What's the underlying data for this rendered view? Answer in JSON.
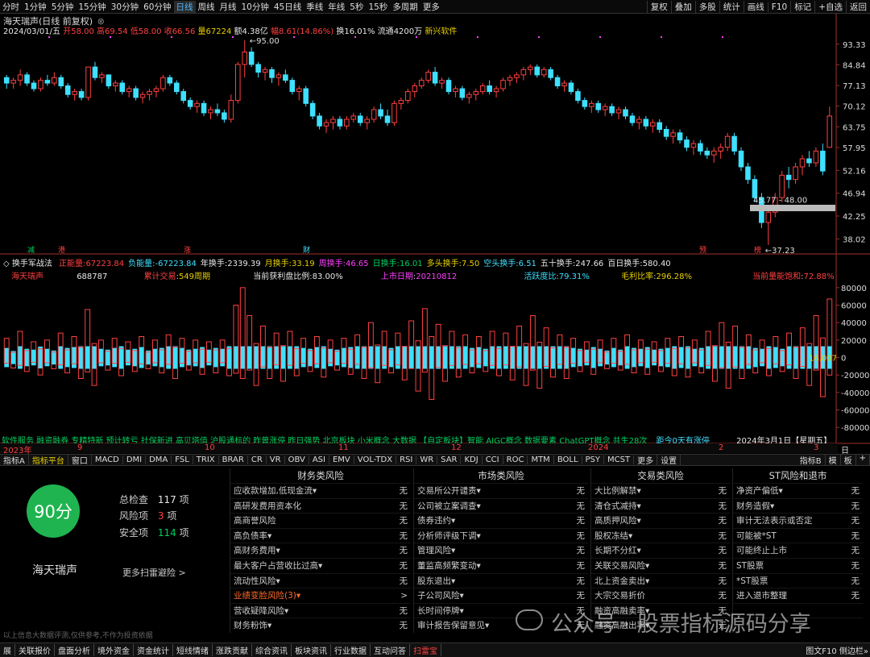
{
  "period_tabs": [
    "分时",
    "1分钟",
    "5分钟",
    "15分钟",
    "30分钟",
    "60分钟",
    "日线",
    "周线",
    "月线",
    "10分钟",
    "45日线",
    "季线",
    "年线",
    "5秒",
    "15秒",
    "多周期",
    "更多"
  ],
  "active_period": "日线",
  "right_tools": [
    "复权",
    "叠加",
    "多股",
    "统计",
    "画线",
    "F10",
    "标记",
    "+自选",
    "返回"
  ],
  "stock": {
    "title": "海天瑞声(日线 前复权)",
    "date": "2024/03/01/五"
  },
  "ohlc": {
    "open_label": "开",
    "open": "58.00",
    "high_label": "高",
    "high": "69.54",
    "low_label": "低",
    "low": "58.00",
    "close_label": "收",
    "close": "66.56",
    "vol_label": "量",
    "vol": "67224",
    "amt_label": "额",
    "amt": "4.38亿",
    "chg_label": "幅",
    "chg": "8.61(14.86%)",
    "turn_label": "换",
    "turn": "16.01%",
    "float_label": "流通",
    "float": "4200万",
    "concept": "新兴软件"
  },
  "price_axis": [
    "93.33",
    "84.84",
    "77.13",
    "70.12",
    "63.75",
    "57.95",
    "52.16",
    "46.94",
    "42.25",
    "38.02"
  ],
  "annotations": {
    "high": "95.00",
    "range": "45.77 - 48.00",
    "low": "37.23"
  },
  "markers": [
    "减",
    "港",
    "涨",
    "财",
    "预",
    "榜"
  ],
  "sub": {
    "name": "换手军战法",
    "items": [
      {
        "label": "正能量",
        "value": "67223.84",
        "color": "red"
      },
      {
        "label": "负能量",
        "value": "-67223.84",
        "color": "cyn"
      },
      {
        "label": "年换手",
        "value": "2339.39",
        "color": "wht"
      },
      {
        "label": "月换手",
        "value": "33.19",
        "color": "yel"
      },
      {
        "label": "周换手",
        "value": "46.65",
        "color": "mag"
      },
      {
        "label": "日换手",
        "value": "16.01",
        "color": "grn"
      },
      {
        "label": "多头换手",
        "value": "7.50",
        "color": "yel"
      },
      {
        "label": "空头换手",
        "value": "6.51",
        "color": "cyn"
      },
      {
        "label": "五十换手",
        "value": "247.66",
        "color": "wht"
      },
      {
        "label": "百日换手",
        "value": "580.40",
        "color": "wht"
      }
    ],
    "row2": {
      "name": "海天瑞声",
      "code": "688787",
      "cycle_label": "累计交易",
      "cycle": "549周期",
      "profit_label": "当前获利盘比例",
      "profit": "83.00%",
      "list_label": "上市日期",
      "list_date": "20210812",
      "active_label": "活跃度比",
      "active": "79.31%",
      "margin_label": "毛利比率",
      "margin": "296.28%",
      "sat_label": "当前量能饱和",
      "sat": "72.88%"
    },
    "axis": [
      "80000",
      "60000",
      "40000",
      "20000",
      "0",
      "-20000",
      "-40000",
      "-60000",
      "-80000"
    ],
    "current": "16.007",
    "bottom_text": "软件服务 融资融券 专精特新 预计转亏 社保新进 高贝塔值 沪股通标的 昨曾涨停 昨日强势 北京板块 小米概念 大数据 【自定板块】智能 AIGC概念 数据要素 ChatGPT概念 共生28次",
    "bottom_right": "距今0天有涨停",
    "bottom_date": "2024年3月1日【星期五】"
  },
  "xaxis": {
    "labels": [
      "2023年",
      "9",
      "10",
      "11",
      "12",
      "2024",
      "2",
      "3"
    ],
    "right": "日线"
  },
  "indicator_tabs": [
    "指标A",
    "指标平台",
    "窗口",
    "MACD",
    "DMI",
    "DMA",
    "FSL",
    "TRIX",
    "BRAR",
    "CR",
    "VR",
    "OBV",
    "ASI",
    "EMV",
    "VOL-TDX",
    "RSI",
    "WR",
    "SAR",
    "KDJ",
    "CCI",
    "ROC",
    "MTM",
    "BOLL",
    "PSY",
    "MCST",
    "更多",
    "设置"
  ],
  "indicator_right": [
    "指标B",
    "模",
    "板",
    "+"
  ],
  "score": {
    "value": "90分",
    "name": "海天瑞声",
    "total_label": "总检查",
    "total": "117",
    "risk_label": "风险项",
    "risk": "3",
    "safe_label": "安全项",
    "safe": "114",
    "unit": "项",
    "more": "更多扫雷避险 >"
  },
  "risk_columns": [
    {
      "title": "财务类风险",
      "items": [
        [
          "应收款增加,低现金流▾",
          "无"
        ],
        [
          "高研发费用资本化",
          "无"
        ],
        [
          "高商誉风险",
          "无"
        ],
        [
          "高负债率▾",
          "无"
        ],
        [
          "高财务费用▾",
          "无"
        ],
        [
          "最大客户占营收比过高▾",
          "无"
        ],
        [
          "流动性风险▾",
          "无"
        ],
        [
          "业绩变脸风险(3)▾",
          ">"
        ],
        [
          "营收疑降风险▾",
          "无"
        ],
        [
          "财务粉饰▾",
          "无"
        ]
      ]
    },
    {
      "title": "市场类风险",
      "items": [
        [
          "交易所公开谴责▾",
          "无"
        ],
        [
          "公司被立案调查▾",
          "无"
        ],
        [
          "债券违约▾",
          "无"
        ],
        [
          "分析师评级下调▾",
          "无"
        ],
        [
          "管理风险▾",
          "无"
        ],
        [
          "董监高频繁变动▾",
          "无"
        ],
        [
          "股东退出▾",
          "无"
        ],
        [
          "子公司风险▾",
          "无"
        ],
        [
          "长时间停牌▾",
          "无"
        ],
        [
          "审计报告保留意见▾",
          "无"
        ]
      ]
    },
    {
      "title": "交易类风险",
      "items": [
        [
          "大比例解禁▾",
          "无"
        ],
        [
          "清仓式减持▾",
          "无"
        ],
        [
          "高质押风险▾",
          "无"
        ],
        [
          "股权冻结▾",
          "无"
        ],
        [
          "长期不分红▾",
          "无"
        ],
        [
          "关联交易风险▾",
          "无"
        ],
        [
          "北上资金卖出▾",
          "无"
        ],
        [
          "大宗交易折价",
          "无"
        ],
        [
          "融资高融卖率▾",
          "无"
        ],
        [
          "融资高融出率▾",
          "无"
        ]
      ]
    },
    {
      "title": "ST风险和退市",
      "items": [
        [
          "净资产偏低▾",
          "无"
        ],
        [
          "财务造假▾",
          "无"
        ],
        [
          "审计无法表示或否定",
          "无"
        ],
        [
          "可能被*ST",
          "无"
        ],
        [
          "可能终止上市",
          "无"
        ],
        [
          "ST股票",
          "无"
        ],
        [
          "*ST股票",
          "无"
        ],
        [
          "进入退市整理",
          "无"
        ],
        [
          "",
          ""
        ],
        [
          "",
          ""
        ]
      ]
    }
  ],
  "disclaimer": "以上信息大数据评测,仅供参考,不作为投资依据",
  "watermark": "公众号 · 股票指标源码分享",
  "status_tabs": [
    "展",
    "关联报价",
    "盘面分析",
    "境外资金",
    "资金统计",
    "短线情绪",
    "涨跌贡献",
    "综合资讯",
    "板块资讯",
    "行业数据",
    "互动问答",
    "扫雷宝"
  ],
  "status_active": "扫雷宝",
  "status_right": "图文F10 侧边栏»",
  "colors": {
    "up": "#ff4040",
    "down": "#3ee0ff",
    "score_green": "#1fb450"
  },
  "chart_data": {
    "type": "candlestick",
    "candles": [
      [
        80,
        81,
        76,
        78
      ],
      [
        78,
        80,
        76,
        79
      ],
      [
        79,
        83,
        77,
        81
      ],
      [
        81,
        82,
        77,
        78
      ],
      [
        78,
        79,
        75,
        76
      ],
      [
        76,
        80,
        75,
        79
      ],
      [
        79,
        81,
        77,
        78
      ],
      [
        78,
        82,
        77,
        80
      ],
      [
        80,
        81,
        76,
        77
      ],
      [
        77,
        78,
        73,
        74
      ],
      [
        74,
        76,
        72,
        75
      ],
      [
        75,
        76,
        72,
        73
      ],
      [
        73,
        84,
        72,
        84
      ],
      [
        84,
        86,
        79,
        80
      ],
      [
        80,
        82,
        78,
        81
      ],
      [
        81,
        81,
        76,
        77
      ],
      [
        77,
        79,
        75,
        78
      ],
      [
        78,
        79,
        74,
        75
      ],
      [
        75,
        77,
        73,
        76
      ],
      [
        76,
        77,
        72,
        73
      ],
      [
        73,
        75,
        71,
        74
      ],
      [
        74,
        76,
        72,
        75
      ],
      [
        75,
        77,
        73,
        76
      ],
      [
        76,
        81,
        75,
        80
      ],
      [
        80,
        81,
        77,
        78
      ],
      [
        78,
        79,
        74,
        75
      ],
      [
        75,
        76,
        71,
        72
      ],
      [
        72,
        73,
        69,
        70
      ],
      [
        70,
        72,
        68,
        71
      ],
      [
        71,
        72,
        67,
        68
      ],
      [
        68,
        70,
        66,
        69
      ],
      [
        69,
        71,
        67,
        68
      ],
      [
        68,
        69,
        65,
        66
      ],
      [
        66,
        74,
        65,
        72
      ],
      [
        72,
        86,
        71,
        85
      ],
      [
        85,
        95,
        80,
        90
      ],
      [
        90,
        92,
        84,
        85
      ],
      [
        85,
        86,
        80,
        82
      ],
      [
        82,
        84,
        79,
        83
      ],
      [
        83,
        84,
        78,
        80
      ],
      [
        80,
        82,
        77,
        81
      ],
      [
        81,
        83,
        78,
        79
      ],
      [
        79,
        80,
        74,
        75
      ],
      [
        75,
        77,
        72,
        76
      ],
      [
        76,
        77,
        70,
        71
      ],
      [
        71,
        72,
        66,
        67
      ],
      [
        67,
        68,
        63,
        64
      ],
      [
        64,
        66,
        62,
        65
      ],
      [
        65,
        67,
        63,
        66
      ],
      [
        66,
        67,
        63,
        64
      ],
      [
        64,
        67,
        63,
        66
      ],
      [
        66,
        68,
        65,
        67
      ],
      [
        67,
        68,
        64,
        65
      ],
      [
        65,
        67,
        63,
        66
      ],
      [
        66,
        70,
        65,
        69
      ],
      [
        69,
        71,
        66,
        67
      ],
      [
        67,
        69,
        64,
        65
      ],
      [
        65,
        72,
        64,
        71
      ],
      [
        71,
        73,
        69,
        72
      ],
      [
        72,
        76,
        71,
        75
      ],
      [
        75,
        78,
        73,
        77
      ],
      [
        77,
        80,
        76,
        79
      ],
      [
        79,
        83,
        78,
        82
      ],
      [
        82,
        84,
        77,
        78
      ],
      [
        78,
        80,
        76,
        79
      ],
      [
        79,
        80,
        74,
        75
      ],
      [
        75,
        77,
        73,
        76
      ],
      [
        76,
        77,
        72,
        73
      ],
      [
        73,
        75,
        71,
        74
      ],
      [
        74,
        76,
        72,
        75
      ],
      [
        75,
        78,
        74,
        77
      ],
      [
        77,
        79,
        74,
        75
      ],
      [
        75,
        77,
        73,
        76
      ],
      [
        76,
        80,
        75,
        79
      ],
      [
        79,
        81,
        77,
        80
      ],
      [
        80,
        82,
        78,
        81
      ],
      [
        81,
        84,
        79,
        83
      ],
      [
        83,
        85,
        81,
        84
      ],
      [
        84,
        85,
        80,
        81
      ],
      [
        81,
        84,
        80,
        83
      ],
      [
        83,
        84,
        79,
        80
      ],
      [
        80,
        81,
        76,
        77
      ],
      [
        77,
        79,
        75,
        78
      ],
      [
        78,
        79,
        74,
        75
      ],
      [
        75,
        76,
        71,
        72
      ],
      [
        72,
        73,
        69,
        70
      ],
      [
        70,
        72,
        68,
        71
      ],
      [
        71,
        72,
        68,
        69
      ],
      [
        69,
        71,
        67,
        70
      ],
      [
        70,
        71,
        67,
        68
      ],
      [
        68,
        70,
        66,
        69
      ],
      [
        69,
        70,
        66,
        67
      ],
      [
        67,
        68,
        64,
        65
      ],
      [
        65,
        67,
        63,
        66
      ],
      [
        66,
        67,
        63,
        64
      ],
      [
        64,
        66,
        62,
        65
      ],
      [
        65,
        66,
        62,
        63
      ],
      [
        63,
        64,
        60,
        61
      ],
      [
        61,
        63,
        59,
        62
      ],
      [
        62,
        63,
        59,
        60
      ],
      [
        60,
        61,
        57,
        58
      ],
      [
        58,
        60,
        56,
        59
      ],
      [
        59,
        60,
        56,
        57
      ],
      [
        57,
        58,
        55,
        56
      ],
      [
        56,
        58,
        54,
        57
      ],
      [
        57,
        59,
        55,
        58
      ],
      [
        58,
        62,
        57,
        61
      ],
      [
        61,
        62,
        56,
        57
      ],
      [
        57,
        58,
        52,
        53
      ],
      [
        53,
        54,
        49,
        50
      ],
      [
        50,
        51,
        45,
        46
      ],
      [
        46,
        47,
        40,
        41
      ],
      [
        41,
        44,
        37,
        43
      ],
      [
        43,
        47,
        42,
        46
      ],
      [
        46,
        52,
        45,
        51
      ],
      [
        51,
        53,
        48,
        50
      ],
      [
        50,
        54,
        49,
        53
      ],
      [
        53,
        56,
        51,
        55
      ],
      [
        55,
        57,
        53,
        54
      ],
      [
        54,
        58,
        53,
        57
      ],
      [
        57,
        59,
        51,
        52
      ],
      [
        58,
        70,
        58,
        67
      ]
    ],
    "volume_energy": [
      22,
      -15,
      30,
      -20,
      18,
      -25,
      20,
      -16,
      28,
      -22,
      24,
      -30,
      55,
      -40,
      20,
      -18,
      22,
      -26,
      18,
      -20,
      24,
      -16,
      20,
      -22,
      26,
      -30,
      22,
      -18,
      20,
      -24,
      18,
      -22,
      20,
      -26,
      60,
      80,
      48,
      -40,
      36,
      -30,
      28,
      -34,
      30,
      -26,
      22,
      -20,
      24,
      -28,
      20,
      -18,
      22,
      -24,
      26,
      -30,
      40,
      -36,
      30,
      -22,
      28,
      -32,
      42,
      -48,
      56,
      -60,
      38,
      -34,
      30,
      -28,
      26,
      -22,
      24,
      -20,
      30,
      -26,
      28,
      -32,
      36,
      -40,
      48,
      -44,
      34,
      -28,
      26,
      -30,
      22,
      -20,
      18,
      -24,
      20,
      -16,
      22,
      -18,
      26,
      -22,
      20,
      -24,
      18,
      -20,
      22,
      -26,
      24,
      -28,
      20,
      -22,
      30,
      -34,
      40,
      -44,
      36,
      -30,
      26,
      -22,
      20,
      -26,
      24,
      -20,
      28,
      -30,
      34,
      -40,
      48,
      -56,
      67
    ]
  }
}
